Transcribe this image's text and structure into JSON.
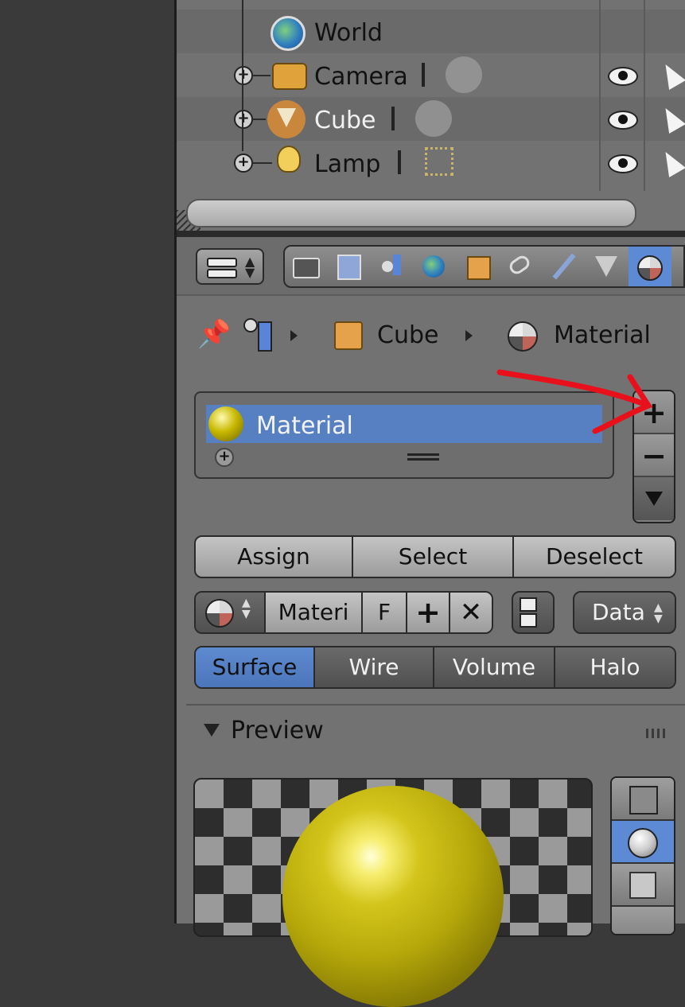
{
  "outliner": {
    "items": [
      {
        "label": "World",
        "icon": "world-icon"
      },
      {
        "label": "Camera",
        "icon": "camera-icon",
        "data_icon": "camera-data-icon"
      },
      {
        "label": "Cube",
        "icon": "mesh-object-icon",
        "data_icon": "mesh-data-icon"
      },
      {
        "label": "Lamp",
        "icon": "lamp-icon",
        "data_icon": "lamp-data-icon"
      }
    ]
  },
  "properties": {
    "context_tabs": [
      "render-icon",
      "render-layers-icon",
      "scene-icon",
      "world-icon",
      "object-icon",
      "constraints-icon",
      "modifiers-icon",
      "data-icon",
      "material-icon"
    ],
    "active_tab": "material-icon",
    "breadcrumb": {
      "object": "Cube",
      "material": "Material"
    },
    "material_slots": [
      {
        "label": "Material",
        "color": "#c8b800"
      }
    ],
    "slot_buttons": {
      "assign": "Assign",
      "select": "Select",
      "deselect": "Deselect"
    },
    "datablock": {
      "name": "Materi",
      "fake_user": "F",
      "link": "Data"
    },
    "material_types": {
      "surface": "Surface",
      "wire": "Wire",
      "volume": "Volume",
      "halo": "Halo",
      "active": "Surface"
    },
    "preview": {
      "title": "Preview"
    }
  },
  "colors": {
    "selection": "#5680c2",
    "annotation_arrow": "#e8101a",
    "panel": "#727272"
  }
}
